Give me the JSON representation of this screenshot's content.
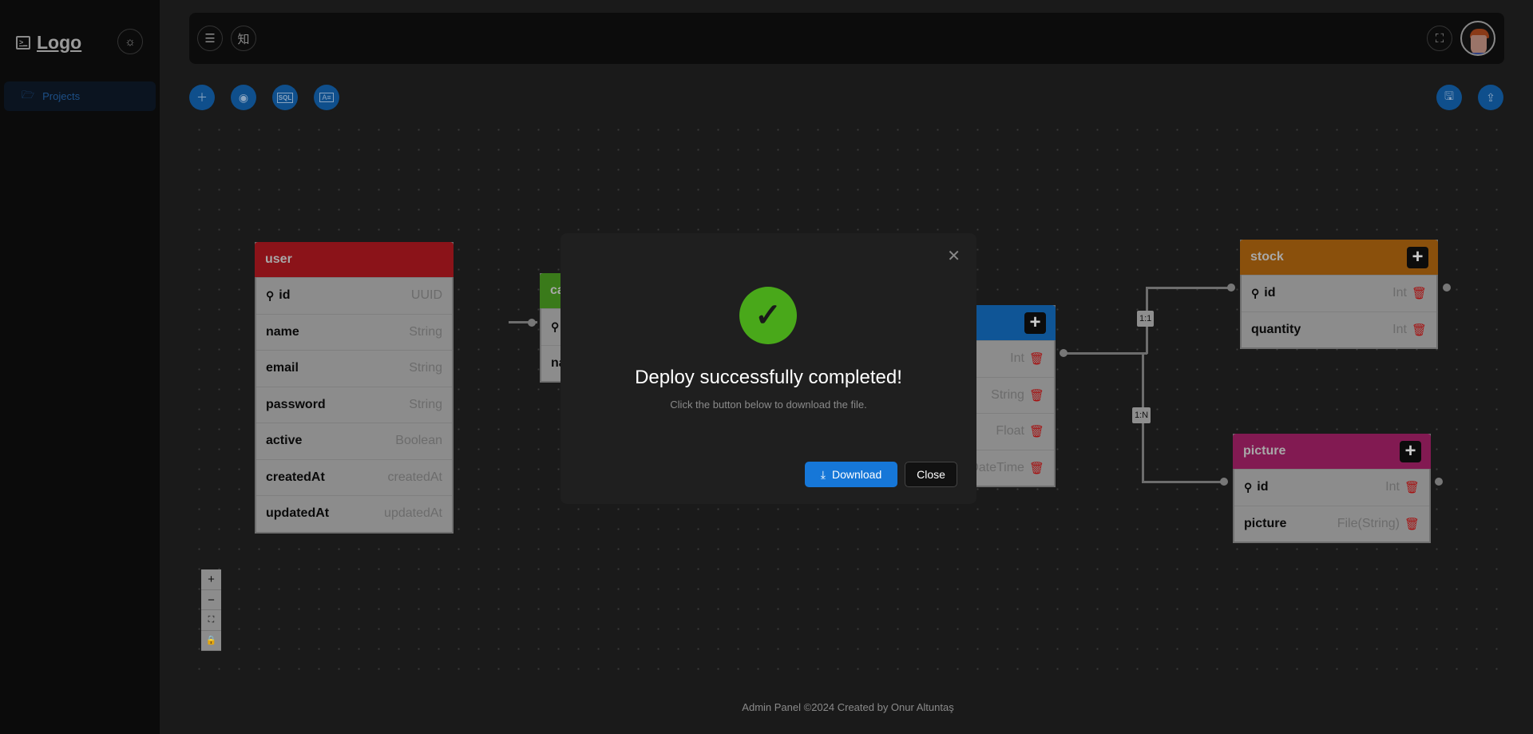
{
  "sidebar": {
    "logo": "Logo",
    "items": [
      {
        "label": "Projects",
        "icon": "folder-icon"
      }
    ]
  },
  "header": {
    "icons": [
      "menu-fold-icon",
      "translate-icon",
      "fullscreen-icon",
      "avatar"
    ],
    "translate_glyph": "知"
  },
  "toolbar": {
    "left": [
      "plus-icon",
      "eye-icon",
      "sql-monitor-icon",
      "text-box-icon"
    ],
    "right": [
      "save-icon",
      "upload-icon"
    ],
    "sql_label": "SQL"
  },
  "tables": [
    {
      "name": "user",
      "color": "#8b1319",
      "rows": [
        {
          "name": "id",
          "type": "UUID",
          "key": true
        },
        {
          "name": "name",
          "type": "String"
        },
        {
          "name": "email",
          "type": "String"
        },
        {
          "name": "password",
          "type": "String"
        },
        {
          "name": "active",
          "type": "Boolean"
        },
        {
          "name": "createdAt",
          "type": "createdAt"
        },
        {
          "name": "updatedAt",
          "type": "updatedAt"
        }
      ],
      "add": false,
      "trash": false
    },
    {
      "name": "category",
      "color": "#3a7a1a",
      "rows": [
        {
          "name": "",
          "type": "",
          "key": true
        },
        {
          "name": "name",
          "type": ""
        }
      ],
      "add": false,
      "trash": false
    },
    {
      "name": "",
      "color": "#0f5596",
      "rows": [
        {
          "name": "",
          "type": "Int"
        },
        {
          "name": "",
          "type": "String"
        },
        {
          "name": "",
          "type": "Float"
        },
        {
          "name": "",
          "type": "DateTime"
        }
      ],
      "add": true,
      "trash": true
    },
    {
      "name": "stock",
      "color": "#8a500c",
      "rows": [
        {
          "name": "id",
          "type": "Int",
          "key": true
        },
        {
          "name": "quantity",
          "type": "Int"
        }
      ],
      "add": true,
      "trash": true
    },
    {
      "name": "picture",
      "color": "#821a52",
      "rows": [
        {
          "name": "id",
          "type": "Int",
          "key": true
        },
        {
          "name": "picture",
          "type": "File(String)"
        }
      ],
      "add": true,
      "trash": true
    }
  ],
  "relations": [
    {
      "label": "1:1"
    },
    {
      "label": "1:N"
    }
  ],
  "zoom_controls": [
    "zoom-in-icon",
    "zoom-out-icon",
    "fit-view-icon",
    "lock-icon"
  ],
  "modal": {
    "title": "Deploy successfully completed!",
    "subtitle": "Click the button below to download the file.",
    "download": "Download",
    "close": "Close",
    "success_color": "#49a81a"
  },
  "footer": "Admin Panel ©2024 Created by Onur Altuntaş"
}
